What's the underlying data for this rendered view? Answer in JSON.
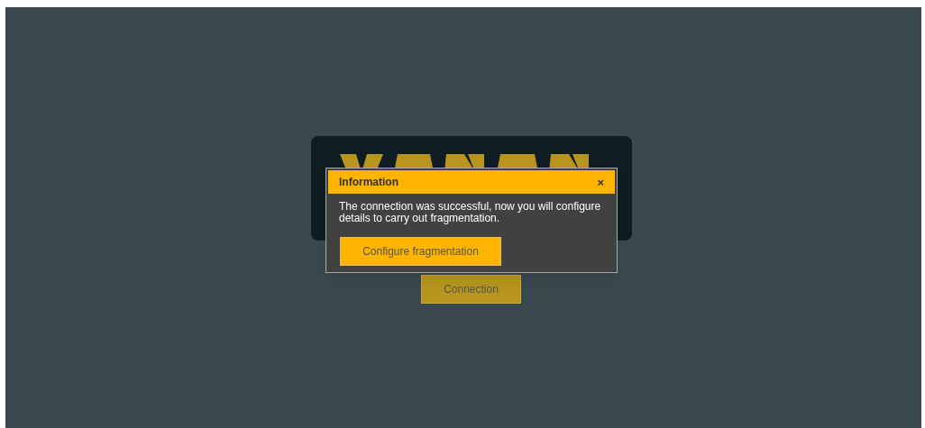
{
  "login": {
    "button": "Connection"
  },
  "dialog": {
    "title": "Information",
    "close": "×",
    "message": "The connection was successful, now you will configure details to carry out fragmentation.",
    "button": "Configure fragmentation"
  }
}
